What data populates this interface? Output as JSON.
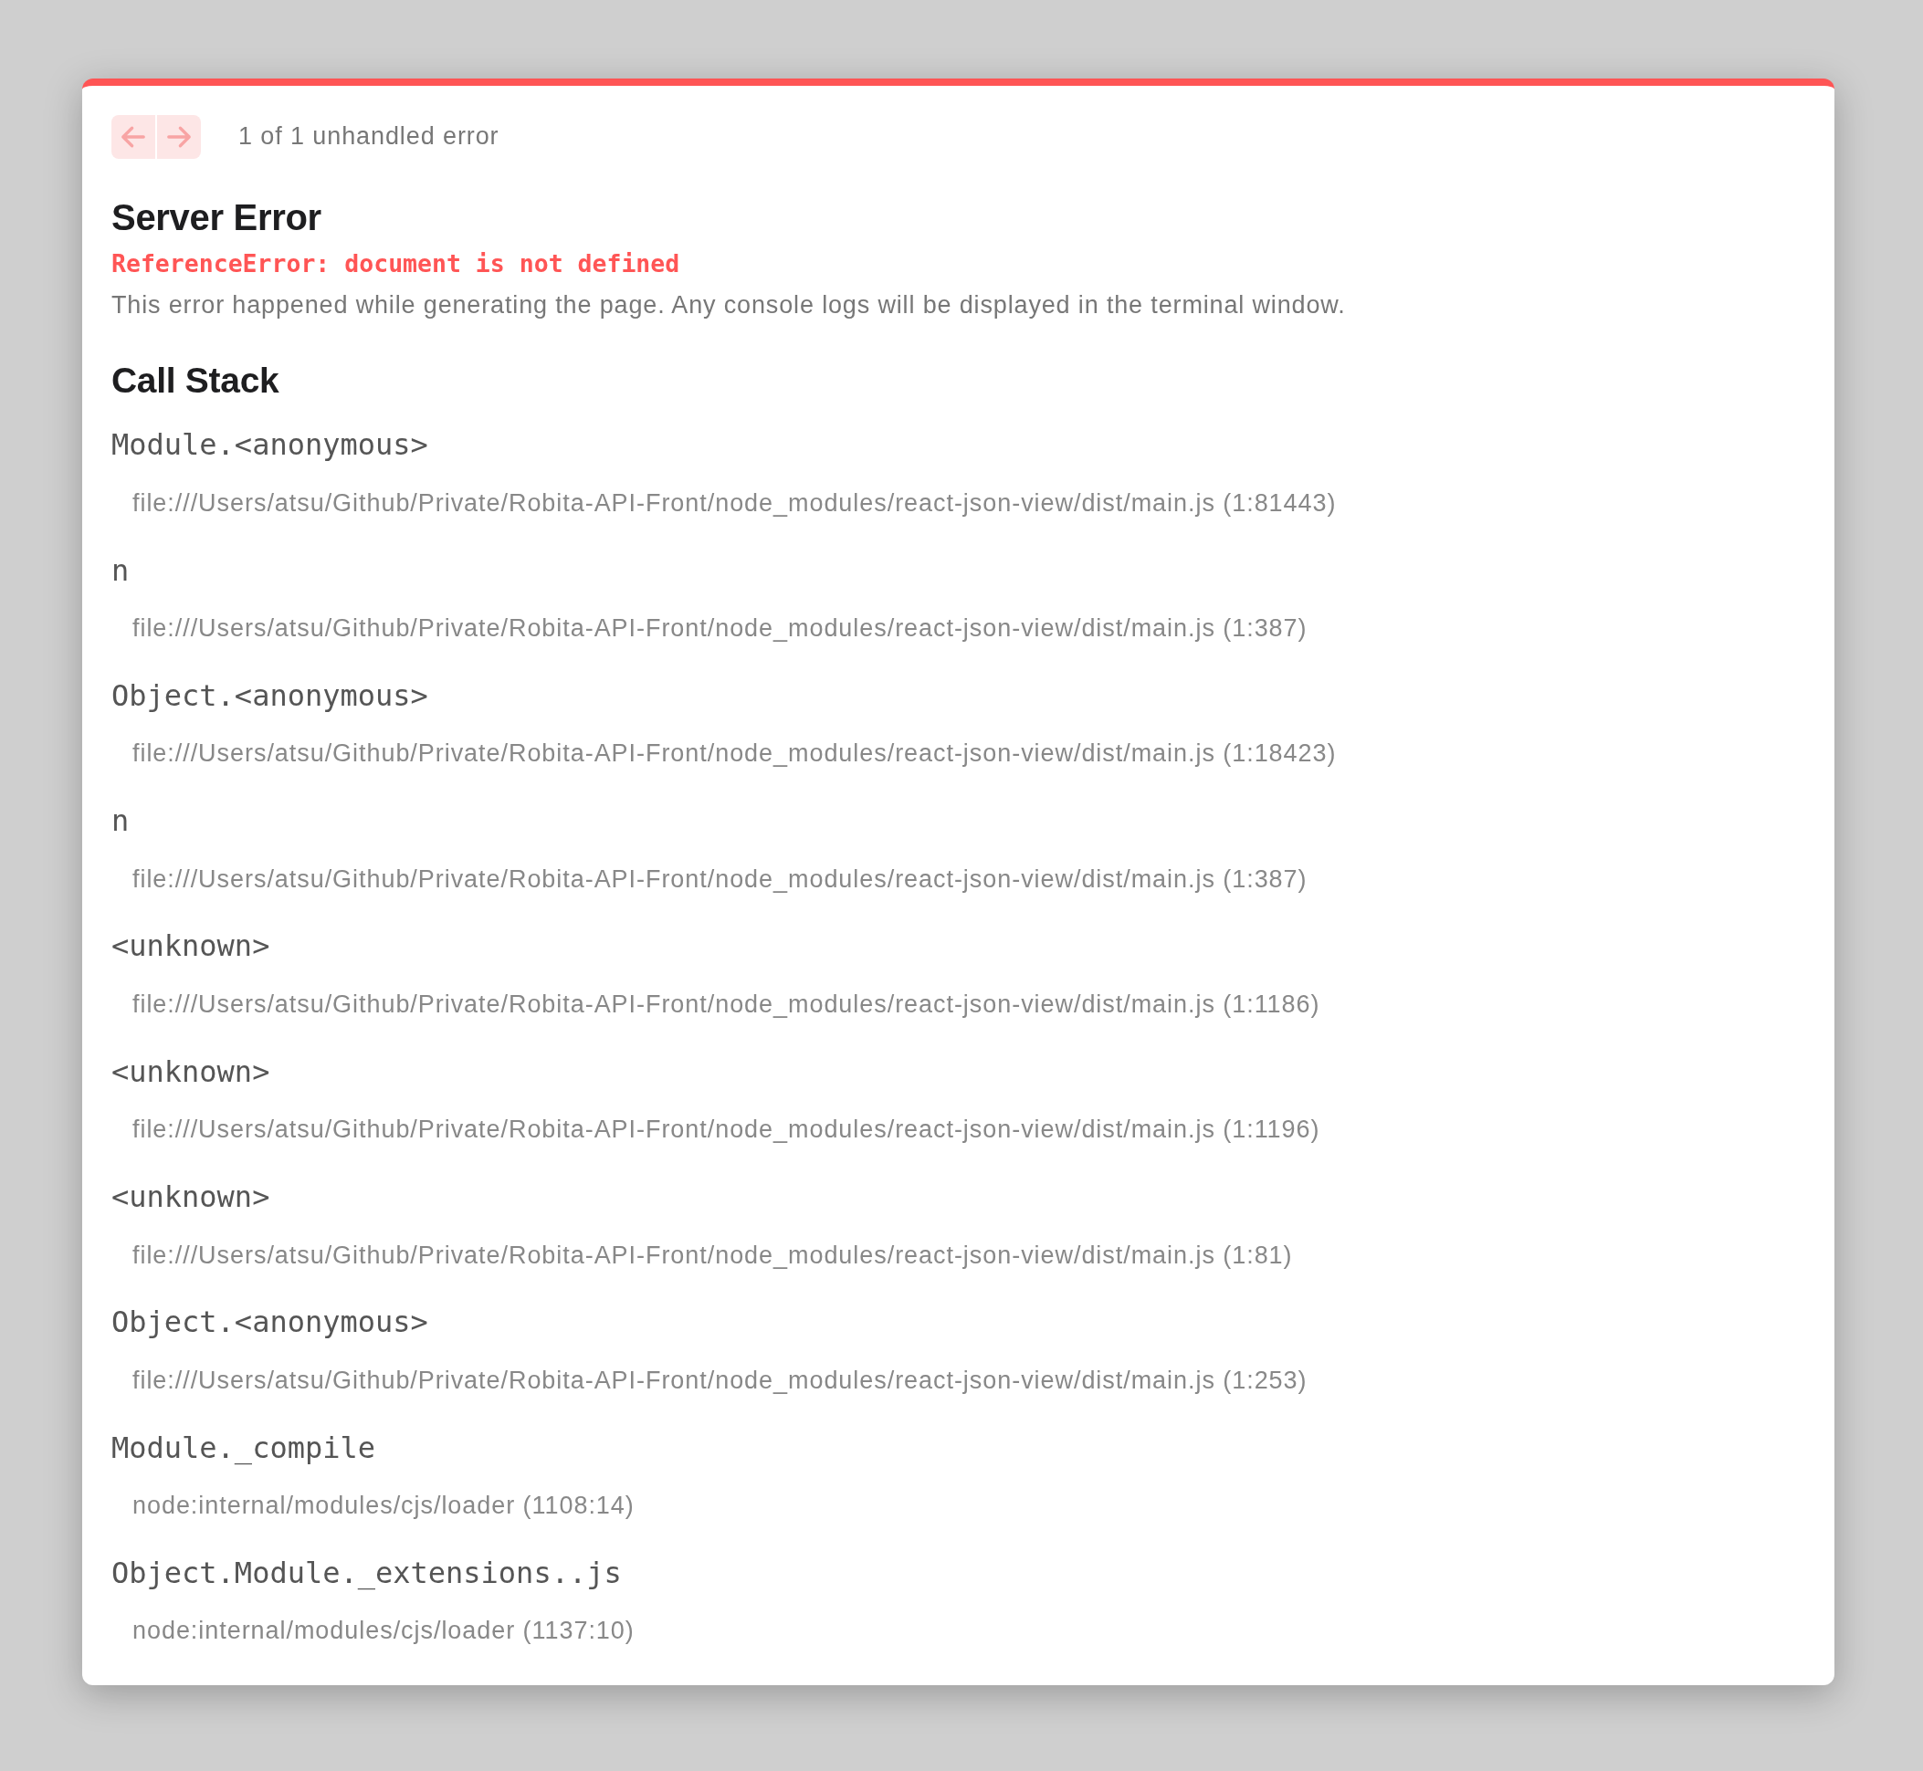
{
  "toolbar": {
    "nav_buttons": [
      {
        "kind": "previous",
        "disabled": true
      },
      {
        "kind": "next",
        "disabled": true
      }
    ],
    "counter": "1 of 1 unhandled error"
  },
  "error": {
    "title": "Server Error",
    "message": "ReferenceError: document is not defined",
    "description": "This error happened while generating the page. Any console logs will be displayed in the terminal window."
  },
  "call_stack": {
    "heading": "Call Stack",
    "frames": [
      {
        "function": "Module.<anonymous>",
        "location": "file:///Users/atsu/Github/Private/Robita-API-Front/node_modules/react-json-view/dist/main.js (1:81443)"
      },
      {
        "function": "n",
        "location": "file:///Users/atsu/Github/Private/Robita-API-Front/node_modules/react-json-view/dist/main.js (1:387)"
      },
      {
        "function": "Object.<anonymous>",
        "location": "file:///Users/atsu/Github/Private/Robita-API-Front/node_modules/react-json-view/dist/main.js (1:18423)"
      },
      {
        "function": "n",
        "location": "file:///Users/atsu/Github/Private/Robita-API-Front/node_modules/react-json-view/dist/main.js (1:387)"
      },
      {
        "function": "<unknown>",
        "location": "file:///Users/atsu/Github/Private/Robita-API-Front/node_modules/react-json-view/dist/main.js (1:1186)"
      },
      {
        "function": "<unknown>",
        "location": "file:///Users/atsu/Github/Private/Robita-API-Front/node_modules/react-json-view/dist/main.js (1:1196)"
      },
      {
        "function": "<unknown>",
        "location": "file:///Users/atsu/Github/Private/Robita-API-Front/node_modules/react-json-view/dist/main.js (1:81)"
      },
      {
        "function": "Object.<anonymous>",
        "location": "file:///Users/atsu/Github/Private/Robita-API-Front/node_modules/react-json-view/dist/main.js (1:253)"
      },
      {
        "function": "Module._compile",
        "location": "node:internal/modules/cjs/loader (1108:14)"
      },
      {
        "function": "Object.Module._extensions..js",
        "location": "node:internal/modules/cjs/loader (1137:10)"
      }
    ]
  }
}
